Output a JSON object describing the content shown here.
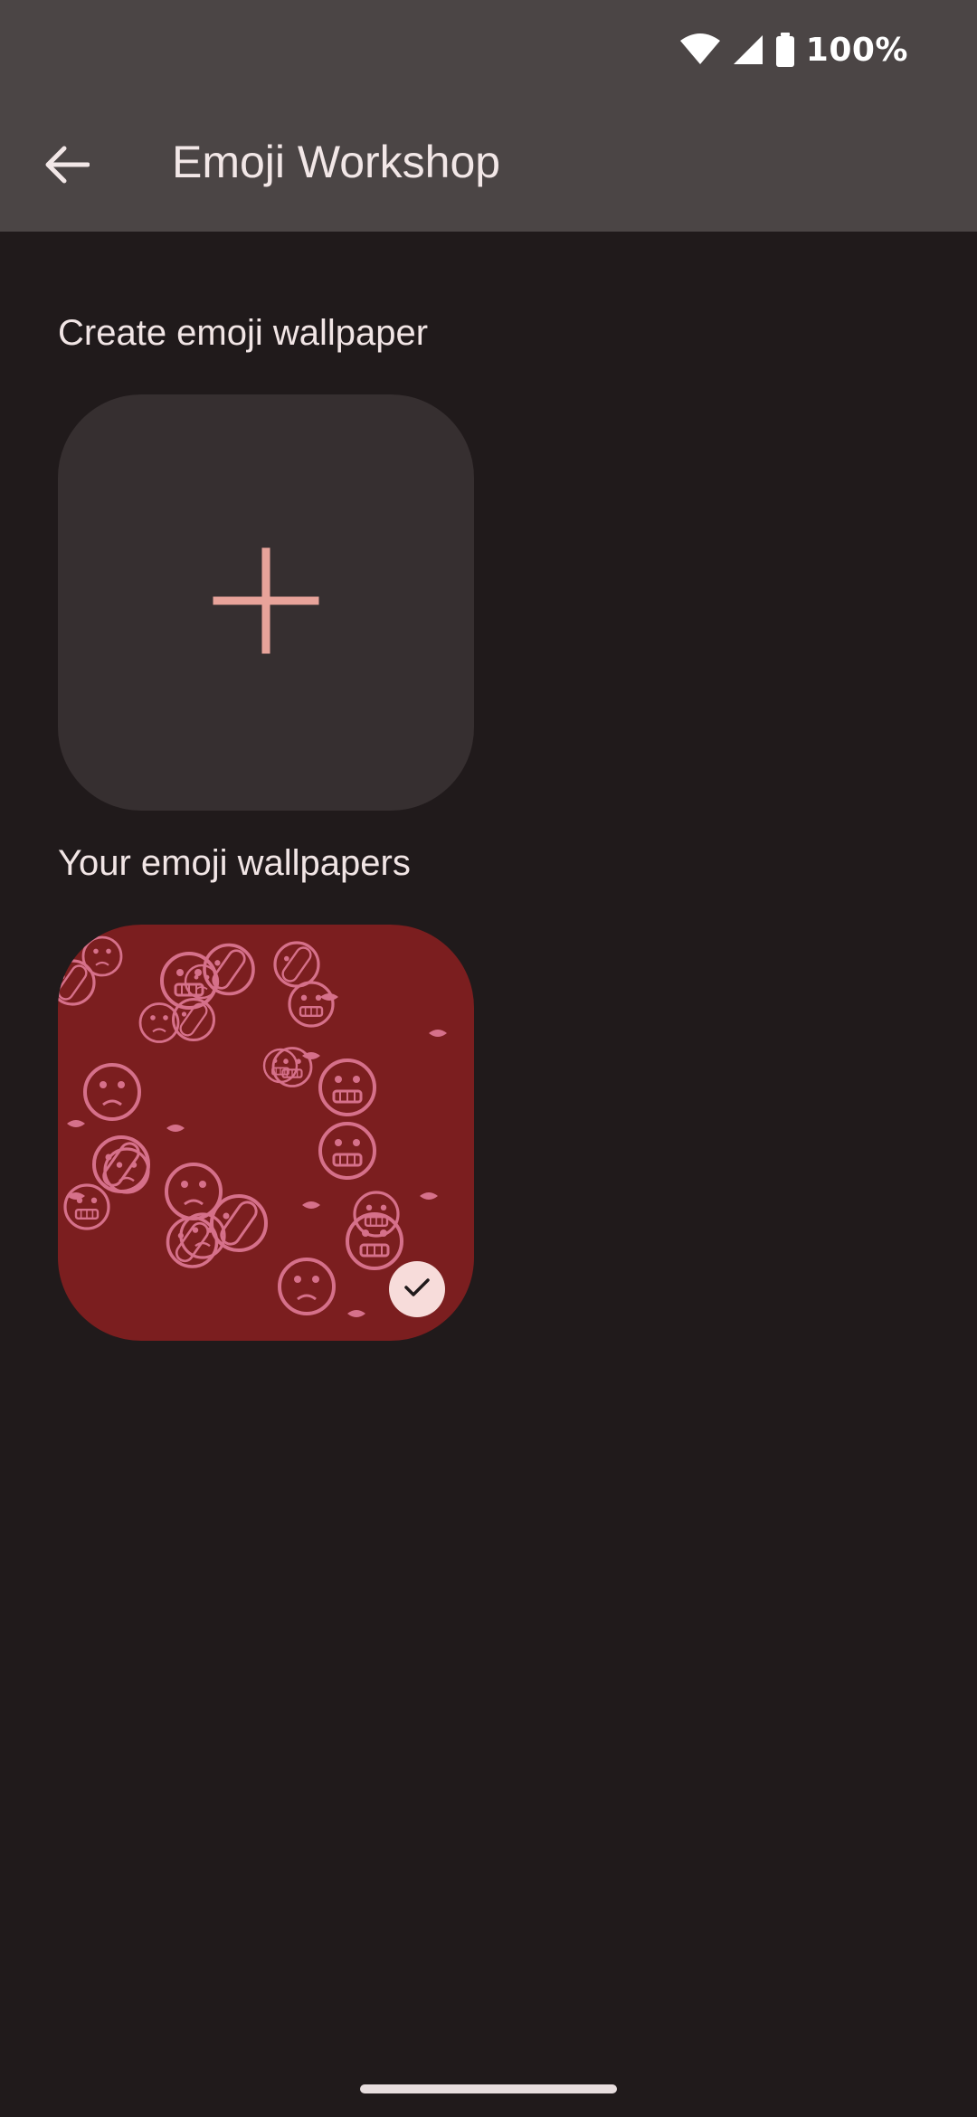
{
  "status_bar": {
    "battery_percent": "100%",
    "icons": [
      "wifi-icon",
      "cell-signal-icon",
      "battery-icon"
    ]
  },
  "app_bar": {
    "title": "Emoji Workshop",
    "back_icon": "arrow-back-icon"
  },
  "create_section": {
    "title": "Create emoji wallpaper",
    "add_icon": "plus-icon"
  },
  "wallpapers_section": {
    "title": "Your emoji wallpapers",
    "items": [
      {
        "selected": true,
        "selected_icon": "checkmark-icon"
      }
    ]
  },
  "colors": {
    "background": "#201a1b",
    "app_bar": "#4b4545",
    "card": "#362f30",
    "accent": "#e8a39a",
    "wallpaper_bg": "#7b1e1f",
    "wallpaper_pattern": "#d6708a"
  }
}
